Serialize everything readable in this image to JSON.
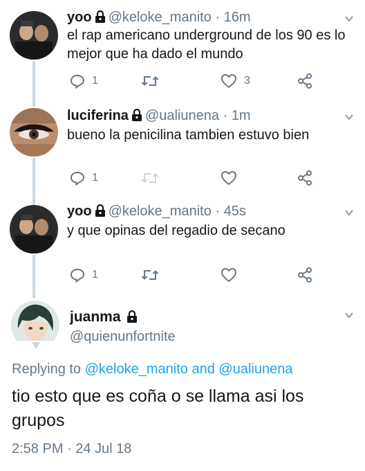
{
  "replies": [
    {
      "name": "yoo",
      "handle": "@keloke_manito",
      "time": "· 16m",
      "text_line1": "el rap americano underground de los 90 es lo",
      "text_line2": "mejor que ha dado el mundo",
      "reply_count": "1",
      "retweet_count": "",
      "like_count": "3"
    },
    {
      "name": "luciferina",
      "handle": "@ualiunena",
      "time": "· 1m",
      "text_line1": "bueno la penicilina tambien estuvo bien",
      "text_line2": "",
      "reply_count": "1",
      "retweet_count": "",
      "like_count": ""
    },
    {
      "name": "yoo",
      "handle": "@keloke_manito",
      "time": "· 45s",
      "text_line1": "y que opinas del regadio de secano",
      "text_line2": "",
      "reply_count": "1",
      "retweet_count": "",
      "like_count": ""
    }
  ],
  "main_tweet": {
    "name": "juanma",
    "handle": "@quienunfortnite",
    "replying_prefix": "Replying to",
    "mention1": "@keloke_manito",
    "replying_and": "and",
    "mention2": "@ualiunena",
    "text_line1": "tio esto que es coña o se llama asi los",
    "text_line2": "grupos",
    "datetime": "2:58 PM · 24 Jul 18"
  },
  "colors": {
    "secondary_text": "#657786",
    "link": "#1da1f2",
    "thread_line": "#ccd6dd"
  }
}
